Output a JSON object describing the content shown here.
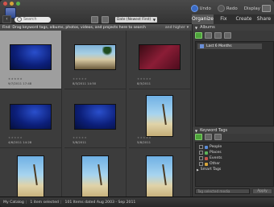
{
  "topbar": {
    "undo": "Undo",
    "redo": "Redo",
    "display": "Display",
    "icons": [
      "undo-icon",
      "redo-icon",
      "display-icon"
    ]
  },
  "toolbar": {
    "search_placeholder": "Search",
    "sort_value": "Date (Newest First)"
  },
  "findbar": {
    "text": "Find: Drag keyword tags, albums, photos, videos, and projects here to search",
    "and_higher": "and higher"
  },
  "panel": {
    "tabs": [
      "Organize",
      "Fix",
      "Create",
      "Share"
    ],
    "albums_title": "Albums",
    "album_item": "Last 6 Months",
    "keyword_tags_title": "Keyword Tags",
    "tags": [
      "People",
      "Places",
      "Events",
      "Other"
    ],
    "smart_tags": "Smart Tags",
    "tag_input_placeholder": "Tag selected media",
    "apply": "Apply"
  },
  "grid": {
    "items": [
      {
        "date": "9/7/2011 17:48"
      },
      {
        "date": "8/3/2011 14:50"
      },
      {
        "date": "8/3/2011"
      },
      {
        "date": "4/6/2011 14:28"
      },
      {
        "date": "5/8/2011"
      },
      {
        "date": "5/8/2011"
      }
    ]
  },
  "status": {
    "catalog": "My Catalog",
    "selected": "1 item selected",
    "range": "101 Items dated Aug 2003 - Sep 2011"
  },
  "colors": {
    "accent": "#5b8dd9",
    "selected_cell": "#9e9e9e",
    "panel_bg": "#3a3a3a"
  }
}
